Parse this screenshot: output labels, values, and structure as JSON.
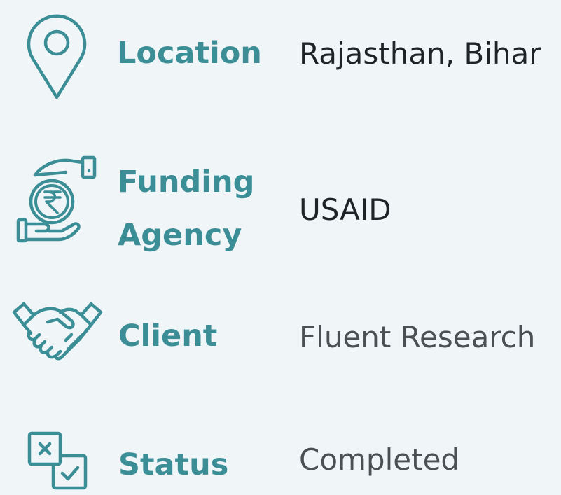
{
  "details": {
    "location": {
      "label": "Location",
      "value": "Rajasthan, Bihar",
      "icon": "map-pin-icon"
    },
    "funding_agency": {
      "label_line1": "Funding",
      "label_line2": "Agency",
      "value": "USAID",
      "icon": "rupee-hands-icon"
    },
    "client": {
      "label": "Client",
      "value": "Fluent Research",
      "icon": "handshake-icon"
    },
    "status": {
      "label": "Status",
      "value": "Completed",
      "icon": "checkbox-status-icon"
    }
  },
  "colors": {
    "accent": "#3b8e96",
    "background": "#f0f5f8",
    "value_dark": "#1f2328",
    "value_grey": "#4c5055"
  }
}
